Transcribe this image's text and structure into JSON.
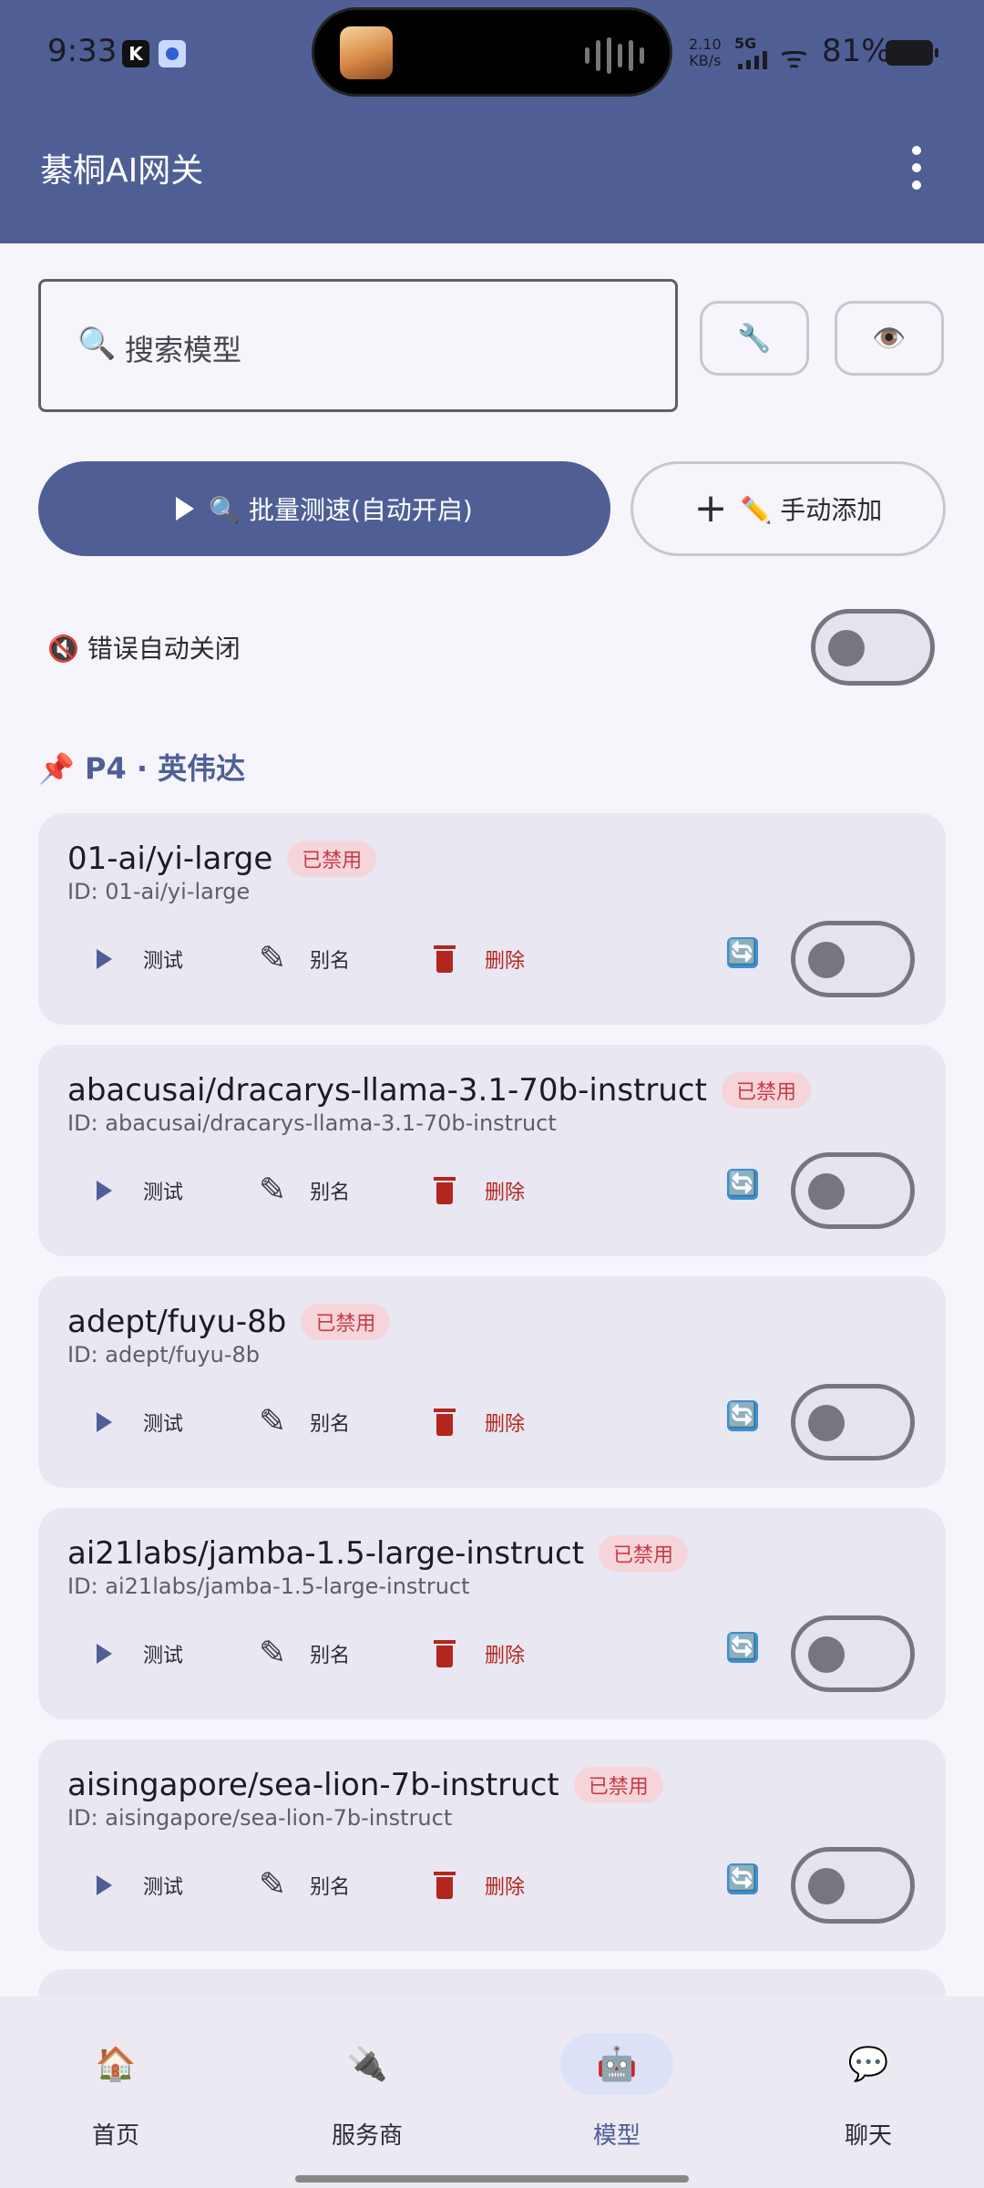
{
  "status": {
    "time": "9:33",
    "net_speed": "2.10",
    "net_unit": "KB/s",
    "network": "5G",
    "battery": "81%"
  },
  "appbar": {
    "title": "綦桐AI网关",
    "menu_icon": "more-vert-icon"
  },
  "search": {
    "icon": "🔍",
    "placeholder": "搜索模型"
  },
  "tools": {
    "wrench": "🔧",
    "eye": "👁️"
  },
  "actions": {
    "batch_label": "🔍 批量测速(自动开启)",
    "add_label": "✏️ 手动添加"
  },
  "auto_close": {
    "label": "🔇 错误自动关闭",
    "enabled": false
  },
  "section": {
    "title": "📌 P4 · 英伟达"
  },
  "card_labels": {
    "disabled": "已禁用",
    "test": "测试",
    "alias": "别名",
    "delete": "删除",
    "refresh": "🔄"
  },
  "models": [
    {
      "name": "01-ai/yi-large",
      "id": "ID: 01-ai/yi-large",
      "status": "已禁用",
      "enabled": false
    },
    {
      "name": "abacusai/dracarys-llama-3.1-70b-instruct",
      "id": "ID: abacusai/dracarys-llama-3.1-70b-instruct",
      "status": "已禁用",
      "enabled": false
    },
    {
      "name": "adept/fuyu-8b",
      "id": "ID: adept/fuyu-8b",
      "status": "已禁用",
      "enabled": false
    },
    {
      "name": "ai21labs/jamba-1.5-large-instruct",
      "id": "ID: ai21labs/jamba-1.5-large-instruct",
      "status": "已禁用",
      "enabled": false
    },
    {
      "name": "aisingapore/sea-lion-7b-instruct",
      "id": "ID: aisingapore/sea-lion-7b-instruct",
      "status": "已禁用",
      "enabled": false
    }
  ],
  "nav": [
    {
      "icon": "🏠",
      "label": "首页",
      "active": false
    },
    {
      "icon": "🔌",
      "label": "服务商",
      "active": false
    },
    {
      "icon": "🤖",
      "label": "模型",
      "active": true
    },
    {
      "icon": "💬",
      "label": "聊天",
      "active": false
    }
  ],
  "colors": {
    "primary": "#4f5f96",
    "danger": "#b3261e",
    "badge_bg": "#f6d5da",
    "card_bg": "#e9e7f2"
  }
}
